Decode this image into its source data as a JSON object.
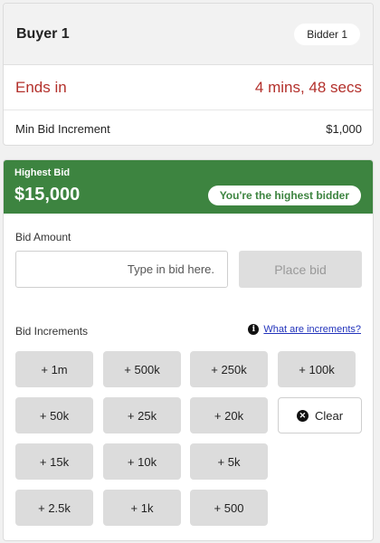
{
  "header": {
    "buyer_name": "Buyer 1",
    "bidder_badge": "Bidder 1"
  },
  "auction": {
    "ends_label": "Ends in",
    "ends_time": "4 mins, 48 secs",
    "min_increment_label": "Min Bid Increment",
    "min_increment_value": "$1,000"
  },
  "highest_bid": {
    "label": "Highest Bid",
    "amount": "$15,000",
    "status": "You're the highest bidder"
  },
  "bid_form": {
    "label": "Bid Amount",
    "placeholder": "Type in bid here.",
    "place_bid_label": "Place bid"
  },
  "increments": {
    "label": "Bid Increments",
    "help_link": "What are increments?",
    "buttons": [
      "+ 1m",
      "+ 500k",
      "+ 250k",
      "+ 100k",
      "+ 50k",
      "+ 25k",
      "+ 20k",
      "+ 15k",
      "+ 10k",
      "+ 5k",
      "+ 2.5k",
      "+ 1k",
      "+ 500"
    ],
    "clear_label": "Clear"
  },
  "colors": {
    "accent_green": "#3d8440",
    "alert_red": "#b3302b",
    "link_blue": "#2233bb"
  }
}
